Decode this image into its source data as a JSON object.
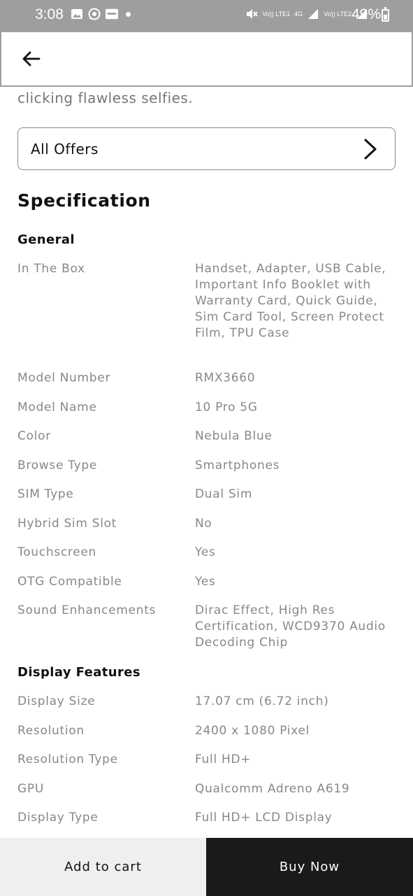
{
  "status_bar": {
    "time": "3:08",
    "battery": "49%",
    "net_labels": [
      "Vo)) LTE1",
      "4G",
      "Vo)) LTE2"
    ],
    "icons": [
      "gallery-icon",
      "whatsapp-icon",
      "paytm-icon",
      "notification-dot-icon",
      "mute-icon",
      "signal-icon",
      "battery-icon"
    ]
  },
  "app_bar": {
    "back_icon": "arrow-left-icon"
  },
  "description_tail": "clicking flawless selfies.",
  "offers": {
    "label": "All Offers",
    "icon": "chevron-right-icon"
  },
  "specification": {
    "title": "Specification",
    "sections": [
      {
        "title": "General",
        "rows": [
          {
            "label": "In The Box",
            "value": "Handset, Adapter, USB Cable, Important Info Booklet with Warranty Card, Quick Guide, Sim Card Tool, Screen Protect Film, TPU Case"
          },
          {
            "label": "Model Number",
            "value": "RMX3660"
          },
          {
            "label": "Model Name",
            "value": "10 Pro 5G"
          },
          {
            "label": "Color",
            "value": "Nebula Blue"
          },
          {
            "label": "Browse Type",
            "value": "Smartphones"
          },
          {
            "label": "SIM Type",
            "value": "Dual Sim"
          },
          {
            "label": "Hybrid Sim Slot",
            "value": "No"
          },
          {
            "label": "Touchscreen",
            "value": "Yes"
          },
          {
            "label": "OTG Compatible",
            "value": "Yes"
          },
          {
            "label": "Sound Enhancements",
            "value": "Dirac Effect, High Res Certification, WCD9370 Audio Decoding Chip"
          }
        ]
      },
      {
        "title": "Display Features",
        "rows": [
          {
            "label": "Display Size",
            "value": "17.07 cm (6.72 inch)"
          },
          {
            "label": "Resolution",
            "value": "2400 x 1080 Pixel"
          },
          {
            "label": "Resolution Type",
            "value": "Full HD+"
          },
          {
            "label": "GPU",
            "value": "Qualcomm Adreno A619"
          },
          {
            "label": "Display Type",
            "value": "Full HD+ LCD Display"
          }
        ]
      }
    ]
  },
  "bottom_bar": {
    "add_to_cart": "Add to cart",
    "buy_now": "Buy Now"
  }
}
